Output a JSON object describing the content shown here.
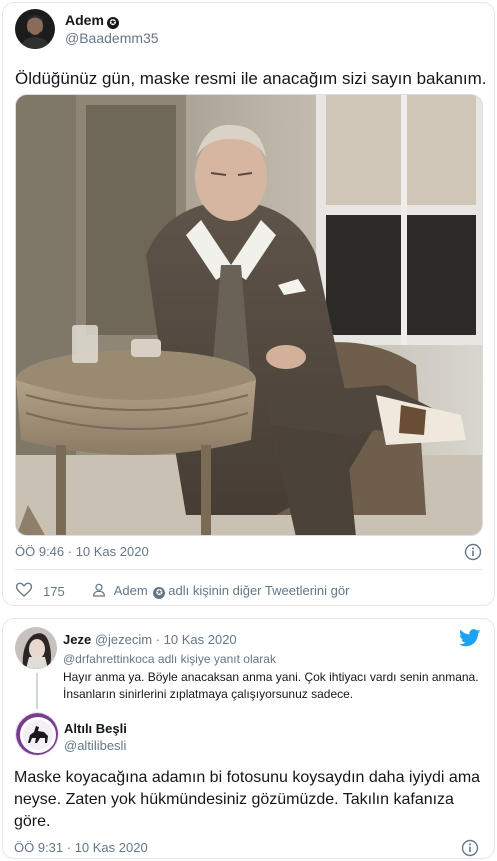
{
  "tweet": {
    "display_name": "Adem",
    "handle": "@Baademm35",
    "text": "Öldüğünüz gün, maske resmi ile anacağım sizi sayın bakanım.",
    "timestamp": "ÖÖ 9:46 · 10 Kas 2020",
    "like_count": "175",
    "more_tweets": "Adem",
    "more_tweets_suffix": "adlı kişinin diğer Tweetlerini gör",
    "verified_icon": "✪"
  },
  "reply1": {
    "display_name": "Jeze",
    "handle": "@jezecim",
    "date": "· 10 Kas 2020",
    "reply_to": "@drfahrettinkoca adlı kişiye yanıt olarak",
    "text": "Hayır anma ya. Böyle anacaksan anma yani. Çok ihtiyacı vardı senin anmana. İnsanların sinirlerini zıplatmaya çalışıyorsunuz sadece."
  },
  "reply2": {
    "display_name": "Altılı Beşli",
    "handle": "@altilibesli",
    "text": "Maske koyacağına adamın bi fotosunu koysaydın daha iyiydi ama neyse. Zaten yok hükmündesiniz gözümüzde. Takılın kafanıza göre.",
    "timestamp": "ÖÖ 9:31 · 10 Kas 2020"
  },
  "colors": {
    "twitter_blue": "#1da1f2",
    "text": "#14171a",
    "muted": "#657786",
    "border": "#e1e8ed"
  }
}
